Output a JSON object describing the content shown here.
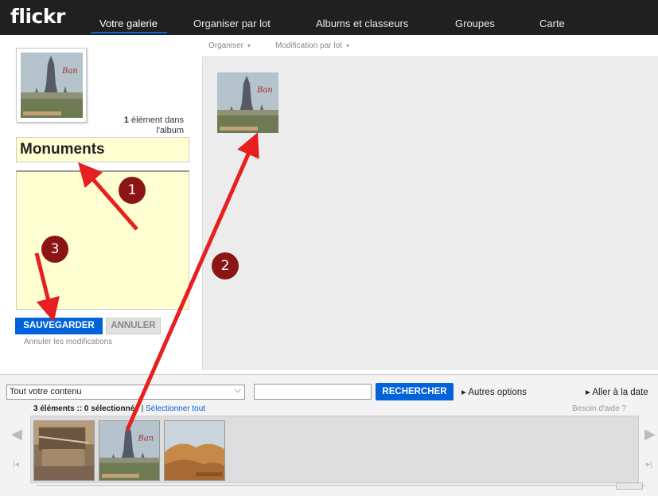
{
  "app": {
    "logo": "flickr"
  },
  "nav": {
    "tabs": [
      {
        "label": "Votre galerie"
      },
      {
        "label": "Organiser par lot"
      },
      {
        "label": "Albums et classeurs"
      },
      {
        "label": "Groupes"
      },
      {
        "label": "Carte"
      }
    ],
    "active_tab": "Votre galerie"
  },
  "toolbar": {
    "organise": "Organiser",
    "batch_edit": "Modification par lot"
  },
  "album": {
    "count_bold": "1",
    "count_text": " élément dans",
    "count_text2": "l'album",
    "title_value": "Monuments",
    "description_value": "",
    "save_label": "SAUVEGARDER",
    "cancel_label": "ANNULER",
    "undo_label": "Annuler les modifications",
    "thumb_caption": "Ban"
  },
  "filter": {
    "select_value": "Tout votre contenu",
    "search_value": "",
    "search_button": "RECHERCHER",
    "more_options": "Autres options",
    "goto_date": "Aller à la date"
  },
  "selection": {
    "count_text": "3 éléments :: 0 sélectionnée",
    "select_all": "Sélectionner tout",
    "separator": " | ",
    "help": "Besoin d'aide ?"
  },
  "annotations": {
    "badge1": "1",
    "badge2": "2",
    "badge3": "3"
  },
  "colors": {
    "accent": "#0063dc",
    "nav_bg": "#202020",
    "annotation_red": "#e62020",
    "badge": "#8b1414",
    "field_bg": "#ffffd2"
  }
}
